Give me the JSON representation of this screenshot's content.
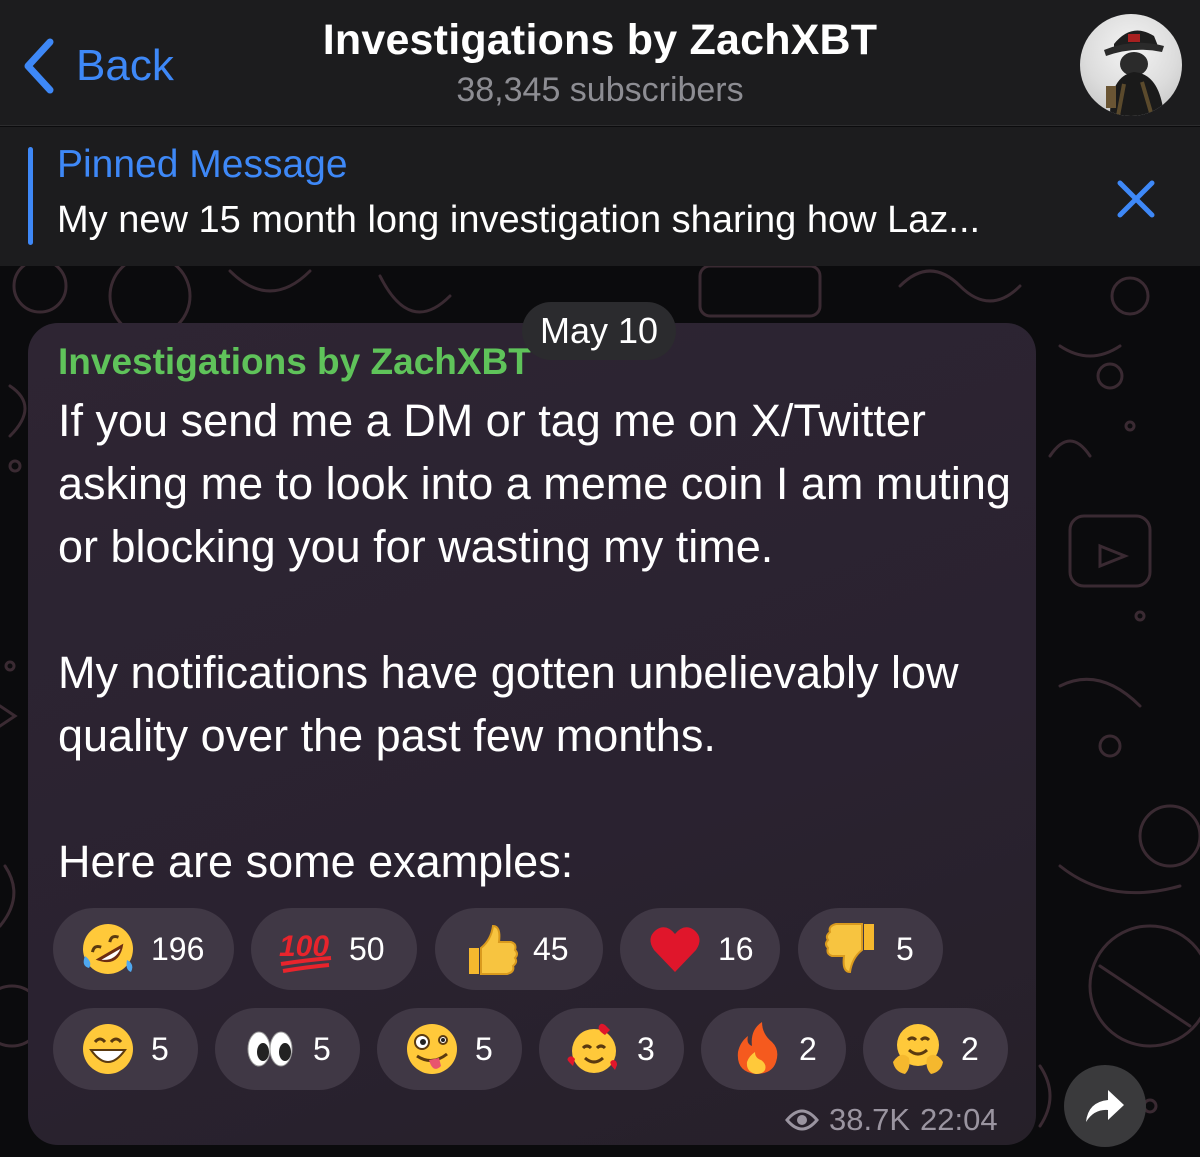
{
  "header": {
    "back_label": "Back",
    "title": "Investigations by ZachXBT",
    "subtitle": "38,345 subscribers"
  },
  "pinned": {
    "title": "Pinned Message",
    "text": "My new 15 month long investigation sharing how Laz..."
  },
  "date_pill": "May 10",
  "message": {
    "sender": "Investigations by ZachXBT",
    "paragraphs": [
      "If you send me a DM or tag me on X/Twitter asking me to look into a meme coin I am muting or blocking you for wasting my time.",
      "My notifications have gotten unbelievably low quality over the past few months.",
      "Here are some examples:"
    ],
    "reactions": [
      {
        "icon": "rolling-on-floor-laughing-icon",
        "count": "196"
      },
      {
        "icon": "hundred-points-icon",
        "count": "50"
      },
      {
        "icon": "thumbs-up-icon",
        "count": "45"
      },
      {
        "icon": "red-heart-icon",
        "count": "16"
      },
      {
        "icon": "thumbs-down-icon",
        "count": "5"
      },
      {
        "icon": "grinning-face-icon",
        "count": "5"
      },
      {
        "icon": "eyes-icon",
        "count": "5"
      },
      {
        "icon": "zany-face-icon",
        "count": "5"
      },
      {
        "icon": "smiling-face-with-hearts-icon",
        "count": "3"
      },
      {
        "icon": "fire-icon",
        "count": "2"
      },
      {
        "icon": "hugging-face-icon",
        "count": "2"
      }
    ],
    "views": "38.7K",
    "time": "22:04"
  },
  "colors": {
    "accent": "#3e88f7",
    "sender": "#5fc35a",
    "bubble": "#2b2330",
    "reaction_bg": "#403845",
    "header_bg": "#1c1c1e"
  }
}
